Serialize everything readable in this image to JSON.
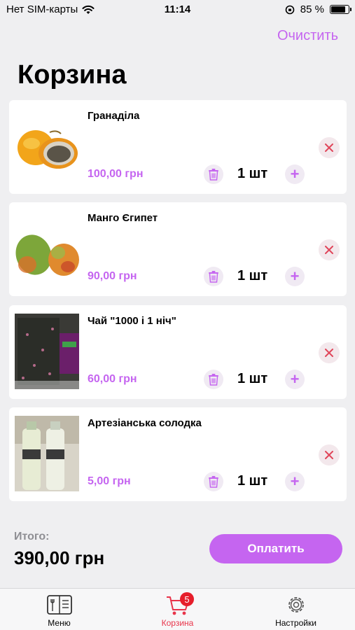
{
  "status_bar": {
    "carrier": "Нет SIM-карты",
    "time": "11:14",
    "battery": "85 %",
    "battery_level": 0.85
  },
  "header": {
    "clear_label": "Очистить",
    "title": "Корзина"
  },
  "cart": {
    "items": [
      {
        "name": "Гранаділа",
        "price": "100,00 грн",
        "qty": "1 шт"
      },
      {
        "name": "Манго Єгипет",
        "price": "90,00 грн",
        "qty": "1 шт"
      },
      {
        "name": "Чай \"1000 і 1 ніч\"",
        "price": "60,00 грн",
        "qty": "1 шт"
      },
      {
        "name": "Артезіанська солодка",
        "price": "5,00 грн",
        "qty": "1 шт"
      }
    ]
  },
  "footer": {
    "total_label": "Итого:",
    "total_value": "390,00 грн",
    "pay_label": "Оплатить"
  },
  "tab_bar": {
    "tabs": [
      {
        "label": "Меню",
        "icon": "menu-book-icon"
      },
      {
        "label": "Корзина",
        "icon": "cart-icon",
        "badge": "5"
      },
      {
        "label": "Настройки",
        "icon": "gear-icon"
      }
    ]
  },
  "colors": {
    "accent": "#c565f0",
    "active_tab": "#e8344a",
    "badge": "#e61e2b",
    "remove": "#e0465a"
  }
}
